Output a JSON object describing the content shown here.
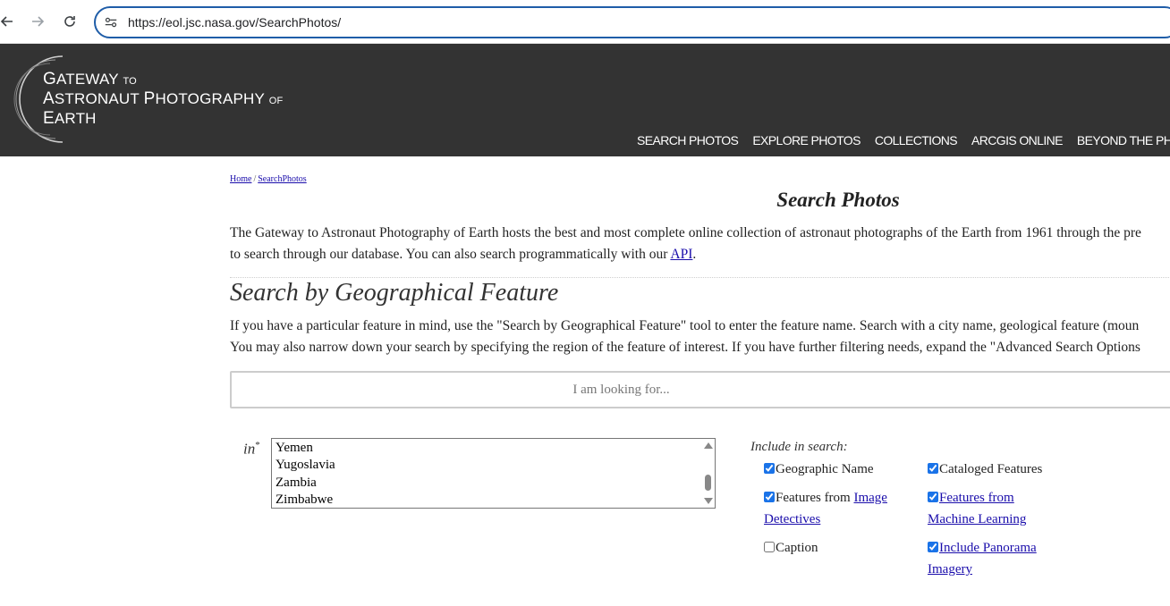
{
  "browser": {
    "url": "https://eol.jsc.nasa.gov/SearchPhotos/"
  },
  "logo": {
    "line1_big": "G",
    "line1_rest": "ATEWAY",
    "line1_small": "TO",
    "line2_big_a": "A",
    "line2_rest_a": "STRONAUT",
    "line2_big_b": "P",
    "line2_rest_b": "HOTOGRAPHY",
    "line2_small": "OF",
    "line3_big": "E",
    "line3_rest": "ARTH"
  },
  "nav": {
    "items": [
      "SEARCH PHOTOS",
      "EXPLORE PHOTOS",
      "COLLECTIONS",
      "ARCGIS ONLINE",
      "BEYOND THE PHOTOGR"
    ]
  },
  "breadcrumb": {
    "home": "Home",
    "separator": "/",
    "current": "SearchPhotos"
  },
  "page": {
    "title": "Search Photos",
    "intro_line1": "The Gateway to Astronaut Photography of Earth hosts the best and most complete online collection of astronaut photographs of the Earth from 1961 through the pre",
    "intro_line2_pre": "to search through our database. You can also search programmatically with our ",
    "intro_api_link": "API",
    "intro_line2_post": "."
  },
  "geo_section": {
    "title": "Search by Geographical Feature",
    "desc_line1": "If you have a particular feature in mind, use the \"Search by Geographical Feature\" tool to enter the feature name. Search with a city name, geological feature (moun",
    "desc_line2": "You may also narrow down your search by specifying the region of the feature of interest. If you have further filtering needs, expand the \"Advanced Search Options",
    "search_placeholder": "I am looking for...",
    "in_label": "in",
    "in_required": "*",
    "region_options": [
      "Yemen",
      "Yugoslavia",
      "Zambia",
      "Zimbabwe"
    ]
  },
  "include": {
    "label": "Include in search:",
    "geographic_name": "Geographic Name",
    "cataloged_features": "Cataloged Features",
    "features_from": "Features from ",
    "image_detectives_a": "Image",
    "image_detectives_b": "Detectives",
    "ml_a": "Features from",
    "ml_b": "Machine Learning",
    "caption": "Caption",
    "panorama_a": "Include Panorama",
    "panorama_b": "Imagery"
  }
}
